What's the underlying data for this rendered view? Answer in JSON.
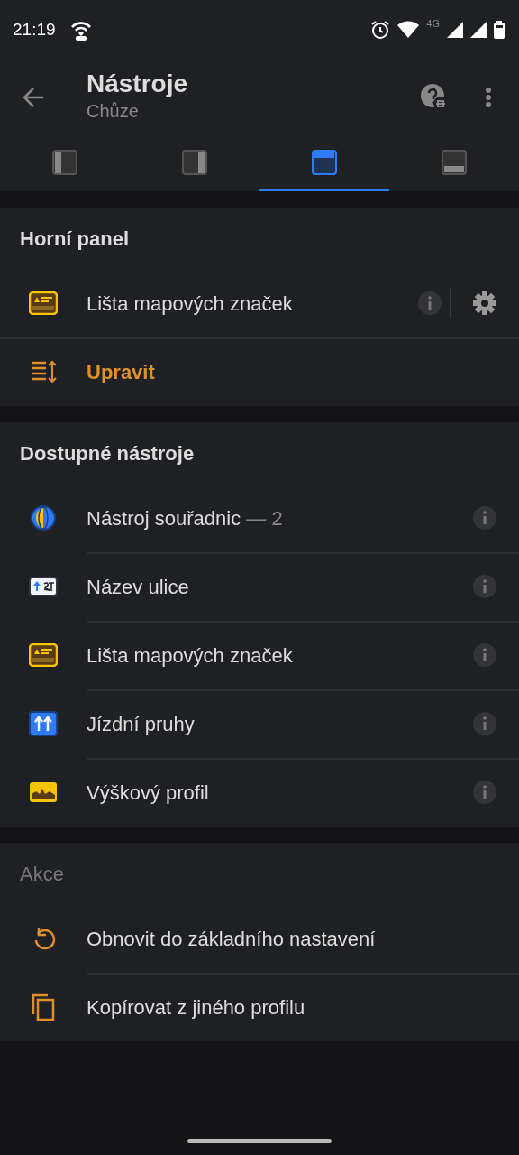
{
  "status_bar": {
    "time": "21:19",
    "network": "4G"
  },
  "header": {
    "title": "Nástroje",
    "subtitle": "Chůze"
  },
  "tabs": [
    {
      "kind": "left",
      "selected": false
    },
    {
      "kind": "right",
      "selected": false
    },
    {
      "kind": "top",
      "selected": true
    },
    {
      "kind": "bottom",
      "selected": false
    }
  ],
  "sections": [
    {
      "title": "Horní panel",
      "muted": false,
      "items": [
        {
          "kind": "markers",
          "label": "Lišta mapových značek",
          "info": true,
          "settings": true
        },
        {
          "kind": "reorder",
          "label": "Upravit",
          "accent": true
        }
      ]
    },
    {
      "title": "Dostupné nástroje",
      "muted": false,
      "items": [
        {
          "kind": "coords",
          "label": "Nástroj souřadnic",
          "suffix": "— 2",
          "info": true
        },
        {
          "kind": "street",
          "label": "Název ulice",
          "info": true
        },
        {
          "kind": "markers",
          "label": "Lišta mapových značek",
          "info": true
        },
        {
          "kind": "lanes",
          "label": "Jízdní pruhy",
          "info": true
        },
        {
          "kind": "elevation",
          "label": "Výškový profil",
          "info": true
        }
      ]
    },
    {
      "title": "Akce",
      "muted": true,
      "items": [
        {
          "kind": "reset",
          "label": "Obnovit do základního nastavení"
        },
        {
          "kind": "copy",
          "label": "Kopírovat z jiného profilu"
        }
      ]
    }
  ]
}
